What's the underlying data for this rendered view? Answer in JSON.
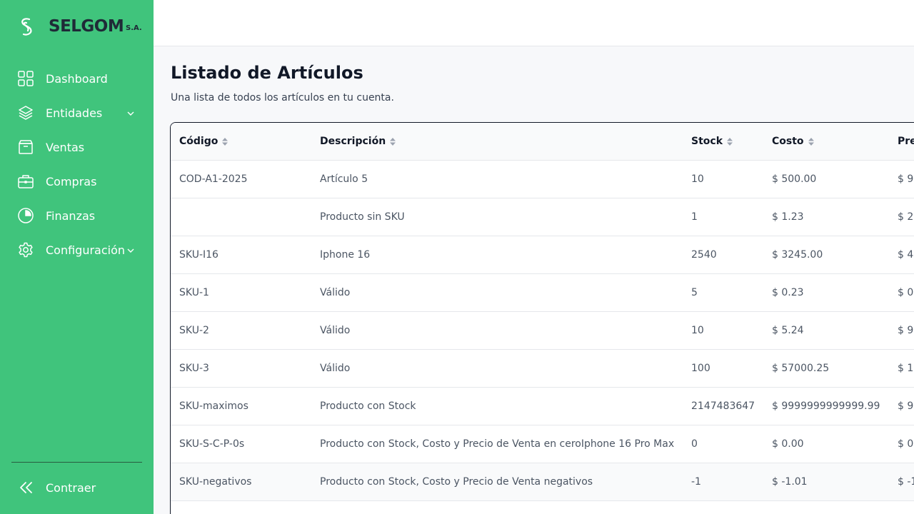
{
  "brand": {
    "name": "SELGOM",
    "suffix": "S.A."
  },
  "sidebar": {
    "items": [
      {
        "label": "Dashboard",
        "icon": "grid-icon"
      },
      {
        "label": "Entidades",
        "icon": "layers-icon",
        "has_submenu": true
      },
      {
        "label": "Ventas",
        "icon": "archive-box-icon"
      },
      {
        "label": "Compras",
        "icon": "briefcase-icon"
      },
      {
        "label": "Finanzas",
        "icon": "pie-chart-icon"
      },
      {
        "label": "Configuración",
        "icon": "gear-icon",
        "has_submenu": true
      }
    ],
    "collapse_label": "Contraer"
  },
  "page": {
    "title": "Listado de Artículos",
    "subtitle": "Una lista de todos los artículos en tu cuenta."
  },
  "table": {
    "columns": [
      "Código",
      "Descripción",
      "Stock",
      "Costo",
      "Precio"
    ],
    "rows": [
      {
        "codigo": "COD-A1-2025",
        "descripcion": "Artículo 5",
        "stock": "10",
        "costo": "$ 500.00",
        "precio": "$ 9"
      },
      {
        "codigo": "",
        "descripcion": "Producto sin SKU",
        "stock": "1",
        "costo": "$ 1.23",
        "precio": "$ 2"
      },
      {
        "codigo": "SKU-I16",
        "descripcion": "Iphone 16",
        "stock": "2540",
        "costo": "$ 3245.00",
        "precio": "$ 4"
      },
      {
        "codigo": "SKU-1",
        "descripcion": "Válido",
        "stock": "5",
        "costo": "$ 0.23",
        "precio": "$ 0"
      },
      {
        "codigo": "SKU-2",
        "descripcion": "Válido",
        "stock": "10",
        "costo": "$ 5.24",
        "precio": "$ 9"
      },
      {
        "codigo": "SKU-3",
        "descripcion": "Válido",
        "stock": "100",
        "costo": "$ 57000.25",
        "precio": "$ 1"
      },
      {
        "codigo": "SKU-maximos",
        "descripcion": "Producto con Stock",
        "stock": "2147483647",
        "costo": "$ 9999999999999.99",
        "precio": "$ 9"
      },
      {
        "codigo": "SKU-S-C-P-0s",
        "descripcion": "Producto con Stock, Costo y Precio de Venta en ceroIphone 16 Pro Max",
        "stock": "0",
        "costo": "$ 0.00",
        "precio": "$ 0"
      },
      {
        "codigo": "SKU-negativos",
        "descripcion": "Producto con Stock, Costo y Precio de Venta negativos",
        "stock": "-1",
        "costo": "$ -1.01",
        "precio": "$ -1"
      }
    ]
  },
  "colors": {
    "sidebar_bg": "#40c47c",
    "text_dark": "#111827",
    "text_muted": "#4b5563"
  }
}
